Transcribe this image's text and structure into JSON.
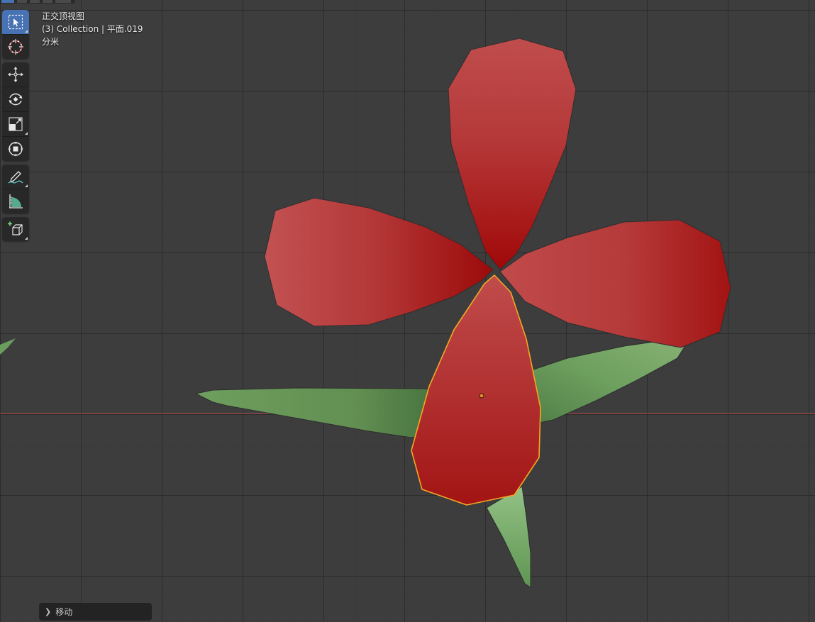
{
  "viewport": {
    "view_name": "正交顶视图",
    "collection_line": "(3) Collection | 平面.019",
    "unit_label": "分米",
    "grid_color": "#3d3d3d",
    "x_axis_color": "#b84a4a"
  },
  "toolbar": {
    "tools": [
      {
        "id": "select-box",
        "icon": "select-box-icon",
        "active": true
      },
      {
        "id": "cursor",
        "icon": "cursor-icon",
        "active": false
      },
      {
        "id": "move",
        "icon": "move-icon",
        "active": false
      },
      {
        "id": "rotate",
        "icon": "rotate-icon",
        "active": false
      },
      {
        "id": "scale",
        "icon": "scale-icon",
        "active": false
      },
      {
        "id": "transform",
        "icon": "transform-icon",
        "active": false
      },
      {
        "id": "annotate",
        "icon": "annotate-icon",
        "active": false
      },
      {
        "id": "measure",
        "icon": "measure-icon",
        "active": false
      },
      {
        "id": "add-cube",
        "icon": "add-cube-icon",
        "active": false
      }
    ]
  },
  "last_operation": {
    "label": "移动"
  },
  "scene": {
    "petal_color": "#b22222",
    "leaf_color": "#6a9a5a",
    "selection_outline_color": "#f5a623",
    "origin_dot_color": "#f08a24"
  }
}
